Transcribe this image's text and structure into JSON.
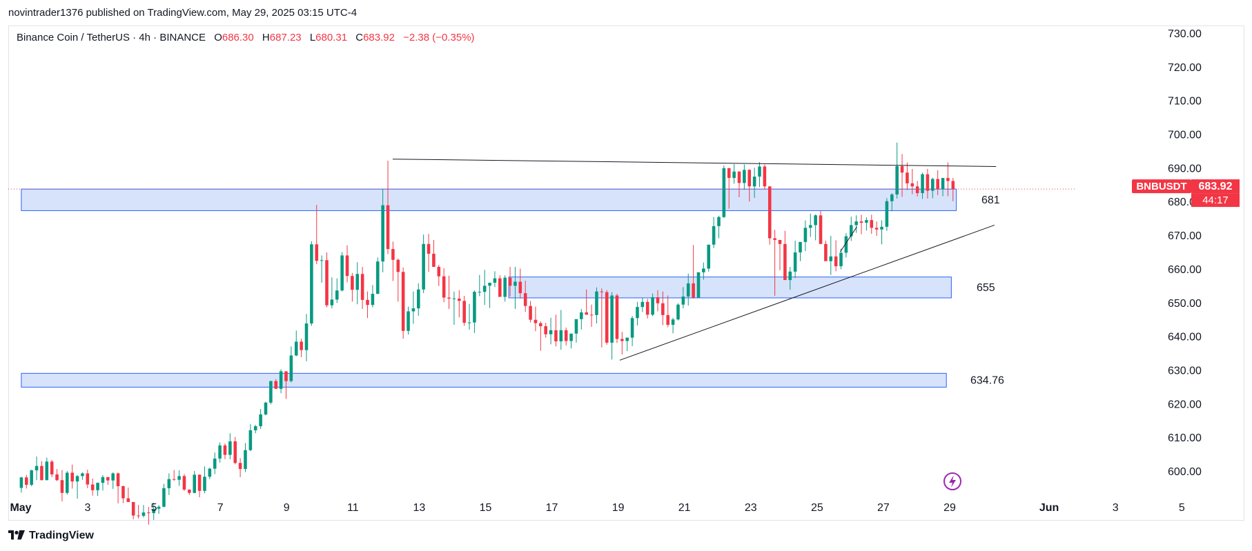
{
  "header": {
    "published_line": "novintrader1376 published on TradingView.com, May 29, 2025 03:15 UTC-4"
  },
  "legend": {
    "symbol_line": "Binance Coin / TetherUS · 4h · BINANCE",
    "open_label": "O",
    "open": "686.30",
    "high_label": "H",
    "high": "687.23",
    "low_label": "L",
    "low": "680.31",
    "close_label": "C",
    "close": "683.92",
    "change": "−2.38 (−0.35%)"
  },
  "price_tag": {
    "symbol": "BNBUSDT",
    "price": "683.92",
    "countdown": "44:17"
  },
  "footer": {
    "brand": "TradingView"
  },
  "colors": {
    "up": "#089981",
    "down": "#f23645",
    "zone_fill": "#c9daf8",
    "zone_stroke": "#2962ff",
    "line": "#131722",
    "price_line": "#f23645",
    "flash_icon": "#9c27b0"
  },
  "chart_data": {
    "type": "candlestick",
    "symbol": "BNBUSDT",
    "timeframe": "4h",
    "y_axis": {
      "ticks": [
        "730.00",
        "720.00",
        "710.00",
        "700.00",
        "690.00",
        "680.00",
        "670.00",
        "660.00",
        "650.00",
        "640.00",
        "630.00",
        "620.00",
        "610.00",
        "600.00"
      ],
      "ylim": [
        591,
        733
      ]
    },
    "x_axis": {
      "ticks": [
        {
          "label": "May",
          "day": 1
        },
        {
          "label": "3",
          "day": 3
        },
        {
          "label": "5",
          "day": 5
        },
        {
          "label": "7",
          "day": 7
        },
        {
          "label": "9",
          "day": 9
        },
        {
          "label": "11",
          "day": 11
        },
        {
          "label": "13",
          "day": 13
        },
        {
          "label": "15",
          "day": 15
        },
        {
          "label": "17",
          "day": 17
        },
        {
          "label": "19",
          "day": 19
        },
        {
          "label": "21",
          "day": 21
        },
        {
          "label": "23",
          "day": 23
        },
        {
          "label": "25",
          "day": 25
        },
        {
          "label": "27",
          "day": 27
        },
        {
          "label": "29",
          "day": 29
        },
        {
          "label": "Jun",
          "day": 32
        },
        {
          "label": "3",
          "day": 34
        },
        {
          "label": "5",
          "day": 36
        }
      ],
      "xlim_days": [
        1,
        37.6
      ]
    },
    "zones": [
      {
        "label": "681",
        "top": 683.9,
        "bottom": 677.5,
        "start_day": 1,
        "end_day": 29.2
      },
      {
        "label": "655",
        "top": 657.8,
        "bottom": 651.6,
        "start_day": 15.7,
        "end_day": 29.05
      },
      {
        "label": "634.76",
        "top": 629.2,
        "bottom": 625.1,
        "start_day": 1,
        "end_day": 28.9
      }
    ],
    "lines": [
      {
        "name": "resistance",
        "from": {
          "day": 12.2,
          "price": 692.8
        },
        "to": {
          "day": 30.4,
          "price": 690.6
        }
      },
      {
        "name": "support",
        "from": {
          "day": 19.05,
          "price": 633.1
        },
        "to": {
          "day": 30.35,
          "price": 673.2
        }
      },
      {
        "name": "micro-trend",
        "from": {
          "day": 25.7,
          "price": 665.3
        },
        "to": {
          "day": 26.2,
          "price": 672.7
        }
      }
    ],
    "candles": [
      [
        595.2,
        598.5,
        593.8,
        598.3
      ],
      [
        598.3,
        599.0,
        595.0,
        596.1
      ],
      [
        596.1,
        600.6,
        595.7,
        600.4
      ],
      [
        600.4,
        604.5,
        597.5,
        601.7
      ],
      [
        601.7,
        603.1,
        597.4,
        597.5
      ],
      [
        597.5,
        604.2,
        597.4,
        603.0
      ],
      [
        603.0,
        603.5,
        598.4,
        599.2
      ],
      [
        599.2,
        600.8,
        597.2,
        597.5
      ],
      [
        597.5,
        600.5,
        591.2,
        593.7
      ],
      [
        593.7,
        600.2,
        593.2,
        599.7
      ],
      [
        599.7,
        602.1,
        595.0,
        597.1
      ],
      [
        597.1,
        599.0,
        592.0,
        598.7
      ],
      [
        598.7,
        599.8,
        597.6,
        599.5
      ],
      [
        599.5,
        600.6,
        595.1,
        596.2
      ],
      [
        596.2,
        598.0,
        592.9,
        594.5
      ],
      [
        594.5,
        596.8,
        592.8,
        596.7
      ],
      [
        596.7,
        599.0,
        594.4,
        598.4
      ],
      [
        598.4,
        598.4,
        596.1,
        597.4
      ],
      [
        597.4,
        599.8,
        594.9,
        599.5
      ],
      [
        599.5,
        599.8,
        590.6,
        595.7
      ],
      [
        595.7,
        595.9,
        590.7,
        592.1
      ],
      [
        592.1,
        595.3,
        591.0,
        591.0
      ],
      [
        591.0,
        591.0,
        585.9,
        587.0
      ],
      [
        587.0,
        590.1,
        586.1,
        586.9
      ],
      [
        586.9,
        590.1,
        586.4,
        587.9
      ],
      [
        587.9,
        589.5,
        584.3,
        587.7
      ],
      [
        587.7,
        590.8,
        585.7,
        589.0
      ],
      [
        589.0,
        590.1,
        587.5,
        589.6
      ],
      [
        589.6,
        596.4,
        589.4,
        595.1
      ],
      [
        595.1,
        599.5,
        593.1,
        597.8
      ],
      [
        597.8,
        600.5,
        597.3,
        597.6
      ],
      [
        597.6,
        600.4,
        595.8,
        598.7
      ],
      [
        598.7,
        599.3,
        594.3,
        594.7
      ],
      [
        594.7,
        594.7,
        593.1,
        593.7
      ],
      [
        593.7,
        600.2,
        593.6,
        599.1
      ],
      [
        599.1,
        599.2,
        592.4,
        594.3
      ],
      [
        594.3,
        601.6,
        593.6,
        598.5
      ],
      [
        598.5,
        601.2,
        597.8,
        600.9
      ],
      [
        600.9,
        605.7,
        599.3,
        603.9
      ],
      [
        603.9,
        608.7,
        602.7,
        607.8
      ],
      [
        607.8,
        608.4,
        603.7,
        605.0
      ],
      [
        605.0,
        611.4,
        603.7,
        609.0
      ],
      [
        609.0,
        610.3,
        602.2,
        602.6
      ],
      [
        602.6,
        604.0,
        598.4,
        600.8
      ],
      [
        600.8,
        608.5,
        599.9,
        606.4
      ],
      [
        606.4,
        614.1,
        606.1,
        612.3
      ],
      [
        612.3,
        613.9,
        611.4,
        613.5
      ],
      [
        613.5,
        618.6,
        612.7,
        617.0
      ],
      [
        617.0,
        620.8,
        616.7,
        620.5
      ],
      [
        620.5,
        627.0,
        620.0,
        626.9
      ],
      [
        626.9,
        627.5,
        624.6,
        624.6
      ],
      [
        624.6,
        630.4,
        623.3,
        629.8
      ],
      [
        629.8,
        629.8,
        621.6,
        626.9
      ],
      [
        626.9,
        637.2,
        626.5,
        634.5
      ],
      [
        634.5,
        641.9,
        634.3,
        638.6
      ],
      [
        638.6,
        639.5,
        634.0,
        636.1
      ],
      [
        636.1,
        646.8,
        632.8,
        644.0
      ],
      [
        644.0,
        668.4,
        643.3,
        667.5
      ],
      [
        667.5,
        679.2,
        661.6,
        662.6
      ],
      [
        662.6,
        664.2,
        656.1,
        662.8
      ],
      [
        662.8,
        665.1,
        648.8,
        649.4
      ],
      [
        649.4,
        657.7,
        648.5,
        651.1
      ],
      [
        651.1,
        657.4,
        650.1,
        653.8
      ],
      [
        653.8,
        665.2,
        653.5,
        664.2
      ],
      [
        664.2,
        667.2,
        656.2,
        658.1
      ],
      [
        658.1,
        659.0,
        650.5,
        654.0
      ],
      [
        654.0,
        662.2,
        649.7,
        658.7
      ],
      [
        658.7,
        660.8,
        648.3,
        651.0
      ],
      [
        651.0,
        653.5,
        645.6,
        649.5
      ],
      [
        649.5,
        655.4,
        648.8,
        652.8
      ],
      [
        652.8,
        663.6,
        652.7,
        662.4
      ],
      [
        662.4,
        684.0,
        659.2,
        679.1
      ],
      [
        679.1,
        692.3,
        664.6,
        666.1
      ],
      [
        666.1,
        668.3,
        656.6,
        662.9
      ],
      [
        662.9,
        663.3,
        650.5,
        659.3
      ],
      [
        659.3,
        660.6,
        639.5,
        641.8
      ],
      [
        641.8,
        649.0,
        640.7,
        647.6
      ],
      [
        647.6,
        653.5,
        643.9,
        648.5
      ],
      [
        648.5,
        655.9,
        646.3,
        654.1
      ],
      [
        654.1,
        670.4,
        653.0,
        667.6
      ],
      [
        667.6,
        670.6,
        659.3,
        664.7
      ],
      [
        664.7,
        668.8,
        661.7,
        660.8
      ],
      [
        660.8,
        661.4,
        655.1,
        658.0
      ],
      [
        658.0,
        660.4,
        650.3,
        651.7
      ],
      [
        651.7,
        658.2,
        648.3,
        651.4
      ],
      [
        651.4,
        653.5,
        643.6,
        651.4
      ],
      [
        651.4,
        653.9,
        645.8,
        650.7
      ],
      [
        650.7,
        652.2,
        643.3,
        644.2
      ],
      [
        644.2,
        649.8,
        642.2,
        644.3
      ],
      [
        644.3,
        653.8,
        641.2,
        653.4
      ],
      [
        653.4,
        658.4,
        652.1,
        653.4
      ],
      [
        653.4,
        659.9,
        649.5,
        655.2
      ],
      [
        655.2,
        656.1,
        648.6,
        656.1
      ],
      [
        656.1,
        659.5,
        654.8,
        657.4
      ],
      [
        657.4,
        658.3,
        652.1,
        651.9
      ],
      [
        651.9,
        658.3,
        650.5,
        657.6
      ],
      [
        657.6,
        660.8,
        652.0,
        655.2
      ],
      [
        655.2,
        660.8,
        648.3,
        656.4
      ],
      [
        656.4,
        660.3,
        651.4,
        653.0
      ],
      [
        653.0,
        656.7,
        647.4,
        649.2
      ],
      [
        649.2,
        650.7,
        644.3,
        645.1
      ],
      [
        645.1,
        649.0,
        641.7,
        644.1
      ],
      [
        644.1,
        644.6,
        635.9,
        643.2
      ],
      [
        643.2,
        644.2,
        639.8,
        640.8
      ],
      [
        640.8,
        645.7,
        637.8,
        642.0
      ],
      [
        642.0,
        646.6,
        637.2,
        638.7
      ],
      [
        638.7,
        648.0,
        636.2,
        642.0
      ],
      [
        642.0,
        642.8,
        637.5,
        638.8
      ],
      [
        638.8,
        640.6,
        636.6,
        641.0
      ],
      [
        641.0,
        645.2,
        638.3,
        645.3
      ],
      [
        645.3,
        648.3,
        642.2,
        647.3
      ],
      [
        647.3,
        654.1,
        646.7,
        646.6
      ],
      [
        646.6,
        649.6,
        643.0,
        646.5
      ],
      [
        646.5,
        654.7,
        644.0,
        653.5
      ],
      [
        653.5,
        654.4,
        636.9,
        653.3
      ],
      [
        653.3,
        653.9,
        637.7,
        638.3
      ],
      [
        638.3,
        653.3,
        633.3,
        652.3
      ],
      [
        652.3,
        652.8,
        638.2,
        639.4
      ],
      [
        639.4,
        641.5,
        634.8,
        638.8
      ],
      [
        638.8,
        639.7,
        635.8,
        639.8
      ],
      [
        639.8,
        646.2,
        637.3,
        645.6
      ],
      [
        645.6,
        650.4,
        643.4,
        648.9
      ],
      [
        648.9,
        651.7,
        647.4,
        650.4
      ],
      [
        650.4,
        651.3,
        645.5,
        646.6
      ],
      [
        646.6,
        652.9,
        646.2,
        651.8
      ],
      [
        651.8,
        653.9,
        647.6,
        650.0
      ],
      [
        650.0,
        653.5,
        643.5,
        646.5
      ],
      [
        646.5,
        652.3,
        642.9,
        643.6
      ],
      [
        643.6,
        645.7,
        641.1,
        645.2
      ],
      [
        645.2,
        650.0,
        644.9,
        649.6
      ],
      [
        649.6,
        654.8,
        648.5,
        652.0
      ],
      [
        652.0,
        658.8,
        649.3,
        655.9
      ],
      [
        655.9,
        667.3,
        651.4,
        651.7
      ],
      [
        651.7,
        659.1,
        651.6,
        659.2
      ],
      [
        659.2,
        662.1,
        657.0,
        660.3
      ],
      [
        660.3,
        667.3,
        659.4,
        667.4
      ],
      [
        667.4,
        675.6,
        666.4,
        672.9
      ],
      [
        672.9,
        676.0,
        669.3,
        675.6
      ],
      [
        675.6,
        690.9,
        675.3,
        690.1
      ],
      [
        690.1,
        690.2,
        678.1,
        687.2
      ],
      [
        687.2,
        691.3,
        685.5,
        689.1
      ],
      [
        689.1,
        689.2,
        681.5,
        685.7
      ],
      [
        685.7,
        691.2,
        683.7,
        689.6
      ],
      [
        689.6,
        689.8,
        680.2,
        684.7
      ],
      [
        684.7,
        690.2,
        681.3,
        687.6
      ],
      [
        687.6,
        691.9,
        684.5,
        690.6
      ],
      [
        690.6,
        691.2,
        683.8,
        684.7
      ],
      [
        684.7,
        684.7,
        667.4,
        669.3
      ],
      [
        669.3,
        671.8,
        652.2,
        668.8
      ],
      [
        668.8,
        668.8,
        659.8,
        667.6
      ],
      [
        667.6,
        671.5,
        659.2,
        656.9
      ],
      [
        656.9,
        660.8,
        654.0,
        659.4
      ],
      [
        659.4,
        668.6,
        657.5,
        665.1
      ],
      [
        665.1,
        668.1,
        662.5,
        668.2
      ],
      [
        668.2,
        674.6,
        665.5,
        672.4
      ],
      [
        672.4,
        676.6,
        669.7,
        673.2
      ],
      [
        673.2,
        676.4,
        668.7,
        676.1
      ],
      [
        676.1,
        677.4,
        669.5,
        667.6
      ],
      [
        667.6,
        668.6,
        664.8,
        662.5
      ],
      [
        662.5,
        670.0,
        658.4,
        663.9
      ],
      [
        663.9,
        668.7,
        659.5,
        661.0
      ],
      [
        661.0,
        666.2,
        660.1,
        665.0
      ],
      [
        665.0,
        670.8,
        663.6,
        669.9
      ],
      [
        669.9,
        675.7,
        668.5,
        673.2
      ],
      [
        673.2,
        676.1,
        670.9,
        674.3
      ],
      [
        674.3,
        676.3,
        670.5,
        673.9
      ],
      [
        673.9,
        675.5,
        671.6,
        674.7
      ],
      [
        674.7,
        676.3,
        670.6,
        672.4
      ],
      [
        672.4,
        674.3,
        670.0,
        671.9
      ],
      [
        671.9,
        674.6,
        667.5,
        672.7
      ],
      [
        672.7,
        681.2,
        671.5,
        680.3
      ],
      [
        680.3,
        682.7,
        677.3,
        682.3
      ],
      [
        682.3,
        697.7,
        681.1,
        690.7
      ],
      [
        690.7,
        694.3,
        681.6,
        688.8
      ],
      [
        688.8,
        691.8,
        683.6,
        685.6
      ],
      [
        685.6,
        689.9,
        682.4,
        684.7
      ],
      [
        684.7,
        686.3,
        681.7,
        682.7
      ],
      [
        682.7,
        688.8,
        681.0,
        688.3
      ],
      [
        688.3,
        689.9,
        681.1,
        683.4
      ],
      [
        683.4,
        687.3,
        681.2,
        686.9
      ],
      [
        686.9,
        689.5,
        682.1,
        683.9
      ],
      [
        683.9,
        685.4,
        681.8,
        687.2
      ],
      [
        687.2,
        691.8,
        681.8,
        686.3
      ],
      [
        686.3,
        687.2,
        680.3,
        683.9
      ]
    ]
  }
}
